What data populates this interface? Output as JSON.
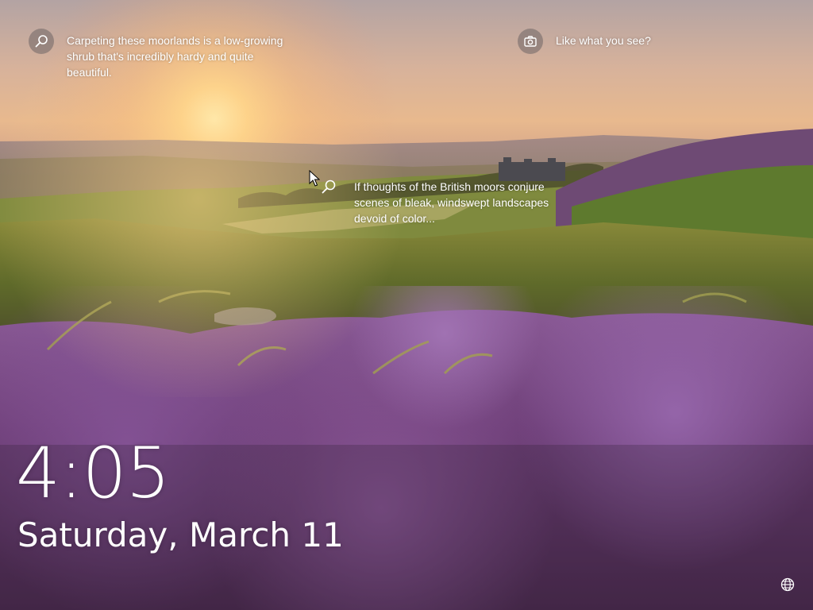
{
  "screen": {
    "type": "lock-screen"
  },
  "spotlight": {
    "top_left": {
      "icon": "search-icon",
      "text": "Carpeting these moorlands is a low-growing shrub that's incredibly hardy and quite beautiful."
    },
    "top_right": {
      "icon": "camera-icon",
      "text": "Like what you see?"
    },
    "middle": {
      "icon": "search-icon",
      "text": "If thoughts of the British moors conjure scenes of bleak, windswept landscapes devoid of color..."
    }
  },
  "clock": {
    "time": "4:05",
    "date": "Saturday, March 11"
  },
  "status": {
    "network_icon": "globe-icon"
  },
  "colors": {
    "sky_top": "#b9a7a4",
    "sky_glow": "#f6c47a",
    "heather": "#7b4a86",
    "fern": "#6d7a2a",
    "text": "#ffffff"
  }
}
